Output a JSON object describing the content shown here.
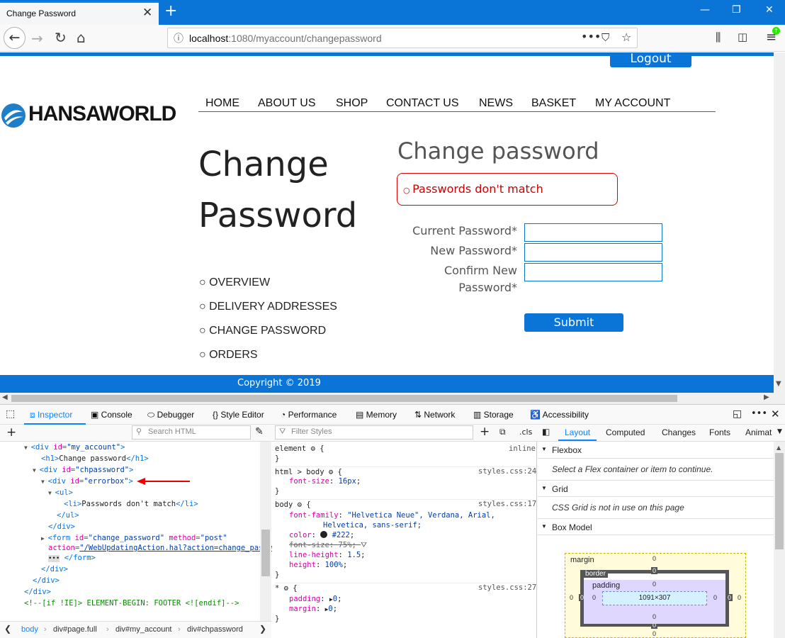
{
  "browser": {
    "tab_title": "Change Password",
    "url_host": "localhost",
    "url_path": ":1080/myaccount/changepassword",
    "window_controls": [
      "—",
      "❐",
      "✕"
    ]
  },
  "page": {
    "logout_label": "Logout",
    "logo_text": "HANSAWORLD",
    "nav": [
      "HOME",
      "ABOUT US",
      "SHOP",
      "CONTACT US",
      "NEWS",
      "BASKET",
      "MY ACCOUNT"
    ],
    "h1_line1": "Change",
    "h1_line2": "Password",
    "side_links": [
      "OVERVIEW",
      "DELIVERY ADDRESSES",
      "CHANGE PASSWORD",
      "ORDERS"
    ],
    "form_title": "Change password",
    "error_message": "Passwords don't match",
    "labels": {
      "current": "Current Password",
      "new": "New Password",
      "confirm_line1": "Confirm New",
      "confirm_line2": "Password"
    },
    "required_mark": "*",
    "submit_label": "Submit",
    "footer_text": "Copyright © 2019"
  },
  "devtools": {
    "tabs": [
      "Inspector",
      "Console",
      "Debugger",
      "Style Editor",
      "Performance",
      "Memory",
      "Network",
      "Storage",
      "Accessibility"
    ],
    "search_html_placeholder": "Search HTML",
    "filter_styles_placeholder": "Filter Styles",
    "cls_label": ".cls",
    "layout_tabs": [
      "Layout",
      "Computed",
      "Changes",
      "Fonts",
      "Animat"
    ],
    "markup_lines": [
      {
        "indent": 2,
        "html": "<div id=\"my_account\">"
      },
      {
        "indent": 3,
        "html": "<h1>Change password</h1>"
      },
      {
        "indent": 2,
        "html": "<div id=\"chpassword\">"
      },
      {
        "indent": 3,
        "html": "<div id=\"errorbox\">"
      },
      {
        "indent": 4,
        "html": "<ul>"
      },
      {
        "indent": 5,
        "html": "<li>Passwords don't match</li>"
      },
      {
        "indent": 4,
        "html": "</ul>"
      },
      {
        "indent": 3,
        "html": "</div>"
      },
      {
        "indent": 3,
        "html": "<form id=\"change_password\" method=\"post\""
      },
      {
        "indent": 3,
        "html": "action=\"/WebUpdatingAction.hal?action=change_passw"
      },
      {
        "indent": 3,
        "html": "</form>"
      },
      {
        "indent": 2,
        "html": "</div>"
      },
      {
        "indent": 1,
        "html": "</div>"
      },
      {
        "indent": 0,
        "html": "</div>"
      },
      {
        "indent": 0,
        "html": "<!--[if !IE]> ELEMENT-BEGIN: FOOTER <![endif]-->"
      }
    ],
    "rules": {
      "element_selector": "element",
      "element_source": "inline",
      "html_body_selector": "html > body",
      "html_body_source": "styles.css:24",
      "html_body_fontsize": "16px",
      "body_selector": "body",
      "body_source": "styles.css:17",
      "body_fontfamily_1": "\"Helvetica Neue\", Verdana, Arial,",
      "body_fontfamily_2": "Helvetica, sans-serif;",
      "body_color": "#222",
      "body_fontsize": "75%",
      "body_lineheight": "1.5",
      "body_height": "100%",
      "star_selector": "*",
      "star_source": "styles.css:27",
      "star_padding": "0",
      "star_margin": "0"
    },
    "layout": {
      "flexbox_title": "Flexbox",
      "flexbox_note": "Select a Flex container or item to continue.",
      "grid_title": "Grid",
      "grid_note": "CSS Grid is not in use on this page",
      "boxmodel_title": "Box Model",
      "margin_label": "margin",
      "border_label": "border",
      "padding_label": "padding",
      "content_size": "1091×307",
      "zero": "0"
    },
    "breadcrumbs": [
      "body",
      "div#page.full",
      "div#my_account",
      "div#chpassword"
    ]
  }
}
